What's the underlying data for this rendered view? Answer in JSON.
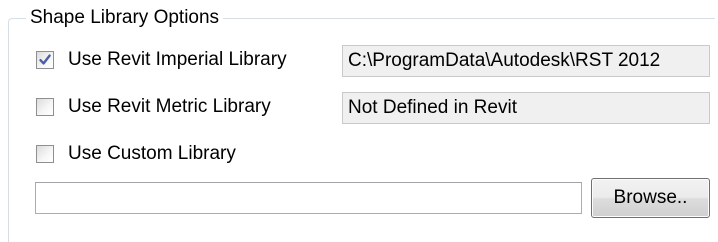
{
  "groupbox": {
    "title": "Shape Library Options"
  },
  "options": [
    {
      "label": "Use Revit Imperial Library",
      "checked": true,
      "path": "C:\\ProgramData\\Autodesk\\RST 2012"
    },
    {
      "label": "Use Revit Metric Library",
      "checked": false,
      "path": "Not Defined in Revit"
    },
    {
      "label": "Use Custom Library",
      "checked": false
    }
  ],
  "custom_path": {
    "value": "",
    "browse_label": "Browse.."
  },
  "colors": {
    "check_tick": "#4a5fa8",
    "readonly_bg": "#f0f0f0",
    "groupbox_border": "#d5dfe5"
  }
}
